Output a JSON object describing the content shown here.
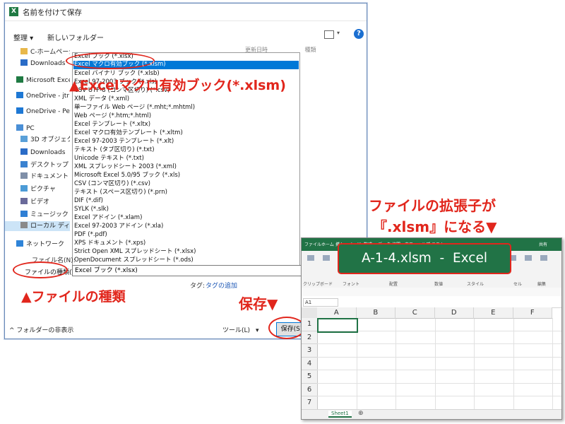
{
  "dialog": {
    "title": "名前を付けて保存",
    "app_icon_letter": "X",
    "toolbar": {
      "organize": "整理 ▾",
      "new_folder": "新しいフォルダー"
    },
    "col_headers": [
      "更新日時",
      "種類"
    ],
    "nav_items": [
      {
        "label": "C-ホームページ",
        "icon": "folder-icon"
      },
      {
        "label": "Downloads",
        "icon": "download-icon"
      },
      {
        "label": "Microsoft Excel",
        "icon": "excel-icon"
      },
      {
        "label": "OneDrive - jtr",
        "icon": "cloud-icon"
      },
      {
        "label": "OneDrive - Pers",
        "icon": "cloud-icon"
      },
      {
        "label": "PC",
        "icon": "pc-icon"
      },
      {
        "label": "3D オブジェクト",
        "icon": "cube-icon"
      },
      {
        "label": "Downloads",
        "icon": "download-icon"
      },
      {
        "label": "デスクトップ",
        "icon": "desktop-icon"
      },
      {
        "label": "ドキュメント",
        "icon": "document-icon"
      },
      {
        "label": "ピクチャ",
        "icon": "picture-icon"
      },
      {
        "label": "ビデオ",
        "icon": "video-icon"
      },
      {
        "label": "ミュージック",
        "icon": "music-icon"
      },
      {
        "label": "ローカル ディスク",
        "icon": "disk-icon"
      },
      {
        "label": "ネットワーク",
        "icon": "network-icon"
      }
    ],
    "file_types": [
      "Excel ブック (*.xlsx)",
      "Excel マクロ有効ブック (*.xlsm)",
      "Excel バイナリ ブック (*.xlsb)",
      "Excel 97-2003 ブック (*.xls)",
      "CSV UTF-8 (コンマ区切り) (*.csv)",
      "XML データ (*.xml)",
      "単一ファイル Web ページ (*.mht;*.mhtml)",
      "Web ページ (*.htm;*.html)",
      "Excel テンプレート (*.xltx)",
      "Excel マクロ有効テンプレート (*.xltm)",
      "Excel 97-2003 テンプレート (*.xlt)",
      "テキスト (タブ区切り) (*.txt)",
      "Unicode テキスト (*.txt)",
      "XML スプレッドシート 2003 (*.xml)",
      "Microsoft Excel 5.0/95 ブック (*.xls)",
      "CSV (コンマ区切り) (*.csv)",
      "テキスト (スペース区切り) (*.prn)",
      "DIF (*.dif)",
      "SYLK (*.slk)",
      "Excel アドイン (*.xlam)",
      "Excel 97-2003 アドイン (*.xla)",
      "PDF (*.pdf)",
      "XPS ドキュメント (*.xps)",
      "Strict Open XML スプレッドシート (*.xlsx)",
      "OpenDocument スプレッドシート (*.ods)"
    ],
    "selected_index": 1,
    "filename_label": "ファイル名(N):",
    "filetype_label": "ファイルの種類(T):",
    "filetype_value": "Excel ブック (*.xlsx)",
    "tags_label": "タグ:",
    "tags_link": "タグの追加",
    "hide_folders": "フォルダーの非表示",
    "tools": "ツール(L)",
    "save": "保存(S)"
  },
  "annotations": {
    "xlsm": "▲Excelマクロ有効ブック(*.xlsm)",
    "filetype": "▲ファイルの種類",
    "save": "保存▼",
    "extension_line1": "ファイルの拡張子が",
    "extension_line2": "『.xlsm』になる▼"
  },
  "excel": {
    "banner": "A-1-4.xlsm  -  Excel",
    "tabs": [
      "ファイル",
      "ホーム",
      "挿入",
      "ページ",
      "数式",
      "データ",
      "校閲",
      "表示",
      "ヘルプ",
      "テスト"
    ],
    "ribbon_groups": [
      "クリップボード",
      "フォント",
      "配置",
      "数値",
      "スタイル",
      "セル",
      "編集"
    ],
    "share": "共有",
    "namebox": "A1",
    "columns": [
      "A",
      "B",
      "C",
      "D",
      "E",
      "F"
    ],
    "rows": [
      "1",
      "2",
      "3",
      "4",
      "5",
      "6",
      "7"
    ],
    "sheet_tab": "Sheet1",
    "colors": {
      "excel_green": "#217346",
      "annotation_red": "#e1261c",
      "highlight_blue": "#0078d7"
    }
  }
}
